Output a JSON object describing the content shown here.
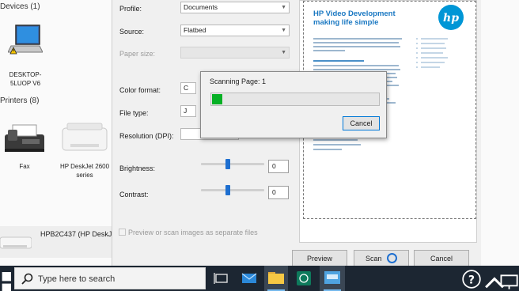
{
  "explorer": {
    "devices_heading": "Devices (1)",
    "printers_heading": "Printers (8)",
    "devices": [
      {
        "label": "DESKTOP-5LUOP V6"
      }
    ],
    "printers": [
      {
        "label": "Fax"
      },
      {
        "label": "HP DeskJet 2600 series"
      }
    ],
    "selected_device": "HPB2C437 (HP DeskJe"
  },
  "scan_dialog": {
    "profile_label": "Profile:",
    "profile_value": "Documents",
    "source_label": "Source:",
    "source_value": "Flatbed",
    "paper_size_label": "Paper size:",
    "paper_size_value": "",
    "color_format_label": "Color format:",
    "color_format_value": "C",
    "file_type_label": "File type:",
    "file_type_value": "J",
    "resolution_label": "Resolution (DPI):",
    "brightness_label": "Brightness:",
    "brightness_value": "0",
    "contrast_label": "Contrast:",
    "contrast_value": "0",
    "separate_files_label": "Preview or scan images as separate files",
    "preview_button": "Preview",
    "scan_button": "Scan",
    "cancel_button": "Cancel"
  },
  "preview_doc": {
    "title_line1": "HP Video Development",
    "title_line2": "making life simple",
    "logo_text": "hp"
  },
  "progress_popup": {
    "caption": "Scanning Page: 1",
    "progress_fraction": 0.06,
    "cancel_button": "Cancel"
  },
  "taskbar": {
    "search_placeholder": "Type here to search"
  },
  "colors": {
    "progress_green": "#06b025",
    "accent_blue": "#1e6fd0",
    "taskbar": "#1c2632",
    "hp_blue": "#0096d6"
  }
}
